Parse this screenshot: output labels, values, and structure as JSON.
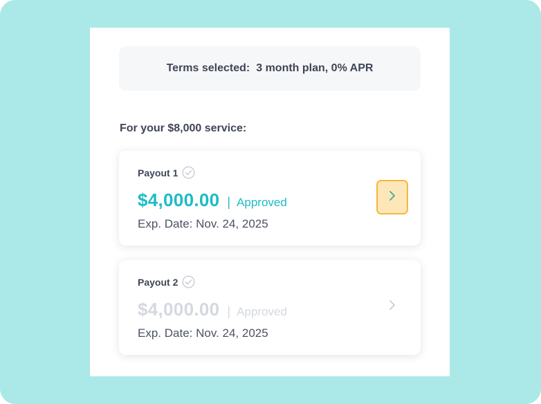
{
  "terms": {
    "label": "Terms selected:",
    "value": "3 month plan, 0% APR"
  },
  "service_heading": "For your $8,000 service:",
  "payouts": [
    {
      "label": "Payout 1",
      "amount": "$4,000.00",
      "separator": "|",
      "status": "Approved",
      "exp_date": "Exp. Date: Nov. 24, 2025",
      "active": true
    },
    {
      "label": "Payout 2",
      "amount": "$4,000.00",
      "separator": "|",
      "status": "Approved",
      "exp_date": "Exp. Date: Nov. 24, 2025",
      "active": false
    }
  ],
  "icons": {
    "check": "check-circle-icon",
    "chevron": "chevron-right-icon"
  },
  "colors": {
    "background": "#abe8e8",
    "accent": "#1dbcc4",
    "text": "#3f4557",
    "muted_amount": "#d4d8e0",
    "highlight_fill": "#fde6b8",
    "highlight_border": "#f6b73c"
  }
}
